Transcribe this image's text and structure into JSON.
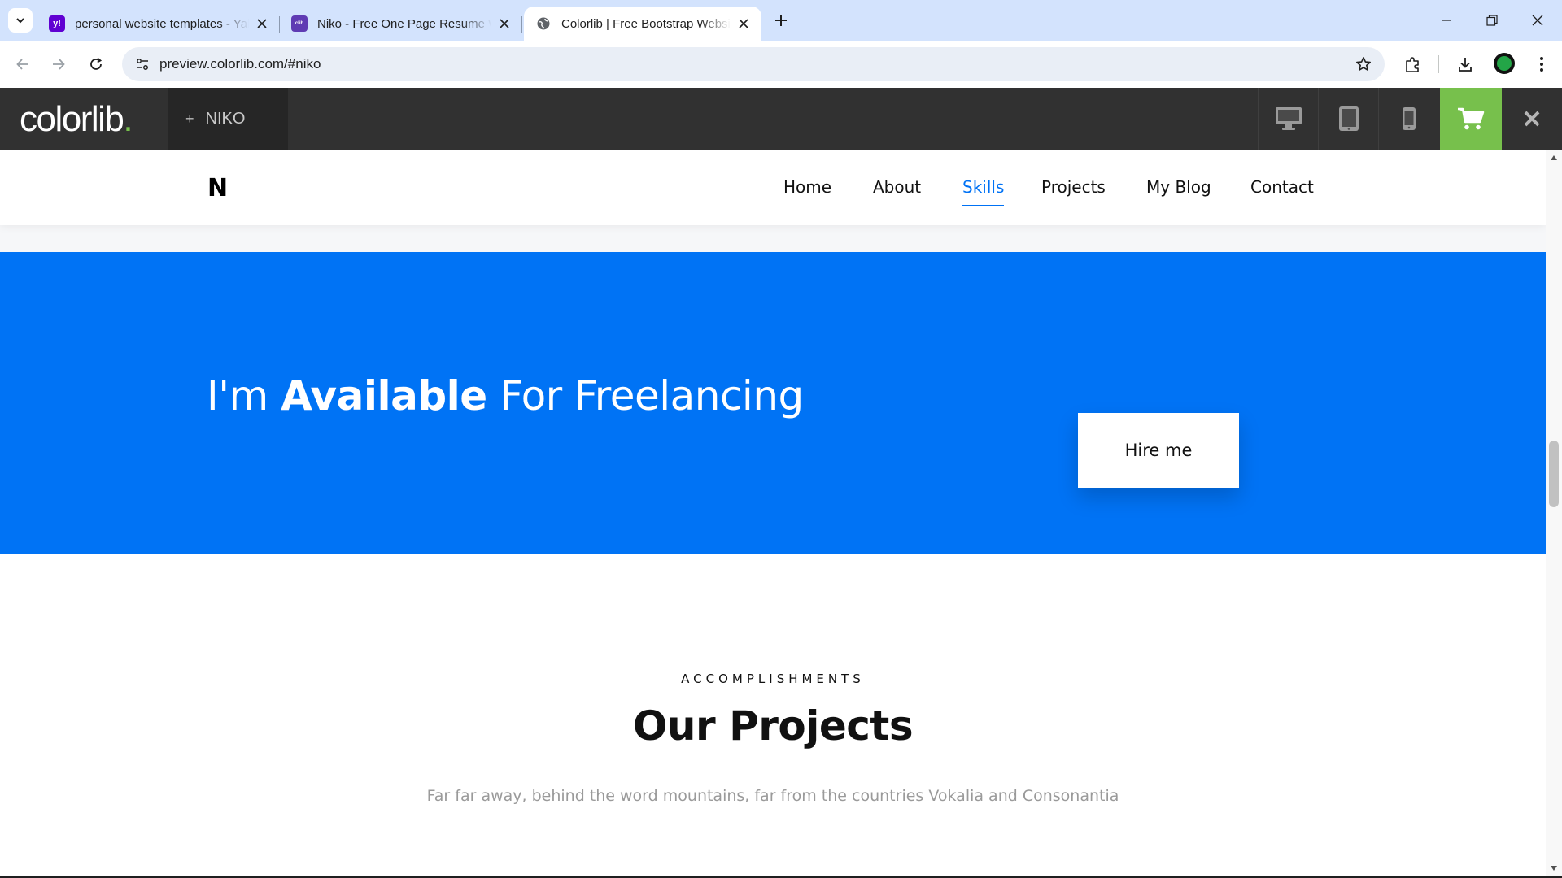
{
  "browser": {
    "tabs": [
      {
        "title": "personal website templates - Yahoo Search Results",
        "favicon": "yahoo-icon",
        "favicon_color": "#6001d2",
        "active": false
      },
      {
        "title": "Niko - Free One Page Resume Website Template",
        "favicon": "colorlib-icon",
        "favicon_color": "#5f3bb3",
        "active": false
      },
      {
        "title": "Colorlib | Free Bootstrap Website Templates",
        "favicon": "globe-icon",
        "favicon_color": "#5f6368",
        "active": true
      }
    ],
    "url": "preview.colorlib.com/#niko"
  },
  "colorlib_bar": {
    "logo_text": "colorlib",
    "logo_dot": ".",
    "theme_name": "NIKO",
    "accent": "#77c04c"
  },
  "site": {
    "logo": "N",
    "menu": [
      {
        "label": "Home",
        "active": false
      },
      {
        "label": "About",
        "active": false
      },
      {
        "label": "Skills",
        "active": true
      },
      {
        "label": "Projects",
        "active": false
      },
      {
        "label": "My Blog",
        "active": false
      },
      {
        "label": "Contact",
        "active": false
      }
    ],
    "hire": {
      "heading_pre": "I'm ",
      "heading_bold": "Available",
      "heading_post": " For Freelancing",
      "button": "Hire me",
      "background": "#0073f5"
    },
    "projects": {
      "subheading": "ACCOMPLISHMENTS",
      "title": "Our Projects",
      "description": "Far far away, behind the word mountains, far from the countries Vokalia and Consonantia"
    }
  }
}
